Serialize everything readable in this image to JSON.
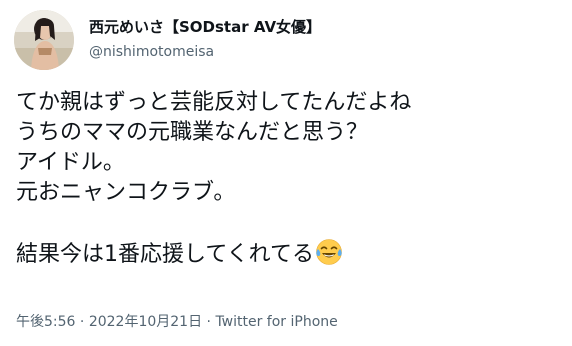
{
  "author": {
    "display_name": "西元めいさ【SODstar AV女優】",
    "handle": "@nishimotomeisa",
    "avatar": "profile-photo"
  },
  "tweet": {
    "lines": [
      "てか親はずっと芸能反対してたんだよね",
      "うちのママの元職業なんだと思う？",
      "アイドル。",
      "元おニャンコクラブ。",
      "",
      "結果今は1番応援してくれてる"
    ],
    "emoji": "face-with-tears-of-joy"
  },
  "meta": {
    "time": "午後5:56",
    "separator": " · ",
    "date": "2022年10月21日",
    "source": "Twitter for iPhone"
  },
  "colors": {
    "text": "#0f1419",
    "secondary": "#536471",
    "background": "#ffffff"
  }
}
